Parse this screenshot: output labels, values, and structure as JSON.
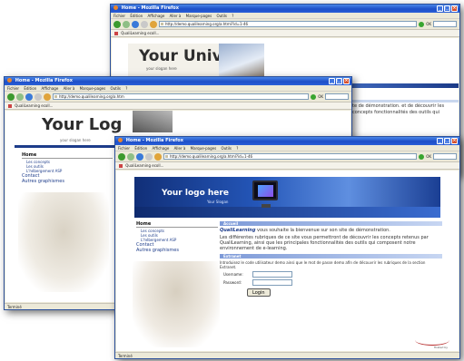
{
  "browser": {
    "window_title": "Home - Mozilla Firefox",
    "menu": [
      "Fichier",
      "Édition",
      "Affichage",
      "Aller à",
      "Marque-pages",
      "Outils",
      "?"
    ],
    "url_back": "http://demo.qualilearning.org/a.html?id=1-46",
    "url_middle": "http://demo.qualilearning.org/a.htm",
    "url_front": "http://demo.qualilearning.org/a.html?id=1-46",
    "go_label": "OK",
    "tab_label": "QualiLearning ecoll...",
    "status": "Terminé"
  },
  "back_window": {
    "logo": "Your Univ",
    "slogan": "your slogan here",
    "text": "te de démonstration. et de découvrir les concepts fonctionnalités des outils qui"
  },
  "middle_window": {
    "logo": "Your Log",
    "slogan": "your slogan here",
    "menu": {
      "home": "Home",
      "items": [
        "Les concepts",
        "Les outils",
        "L'hébergement ASP"
      ],
      "contact": "Contact",
      "graphismes": "Autres graphismes"
    }
  },
  "front_window": {
    "logo": "Your logo here",
    "slogan": "Your Slogan",
    "menu": {
      "home": "Home",
      "items": [
        "Les concepts",
        "Les outils",
        "L'hébergement ASP"
      ],
      "contact": "Contact",
      "graphismes": "Autres graphismes"
    },
    "accueil_header": "Accueil",
    "welcome_brand": "QualiLearning",
    "welcome_rest": " vous souhaite la bienvenue sur son site de démonstration.",
    "para_1": "Les différentes rubriques de ce site vous permettront de découvrir les concepts",
    "para_2": "retenus par QualiLearning, ainsi que les principales fonctionnalités des outils qui composent notre environnement de e-learning.",
    "extranet_header": "Extranet",
    "extranet_intro": "Introduisez le code utilisateur demo ainsi que le mot de passe demo afin de découvrir les rubriques de la section Extranet.",
    "username_label": "Username:",
    "password_label": "Password:",
    "login_label": "Login",
    "hosted_by": "Hosted by"
  }
}
